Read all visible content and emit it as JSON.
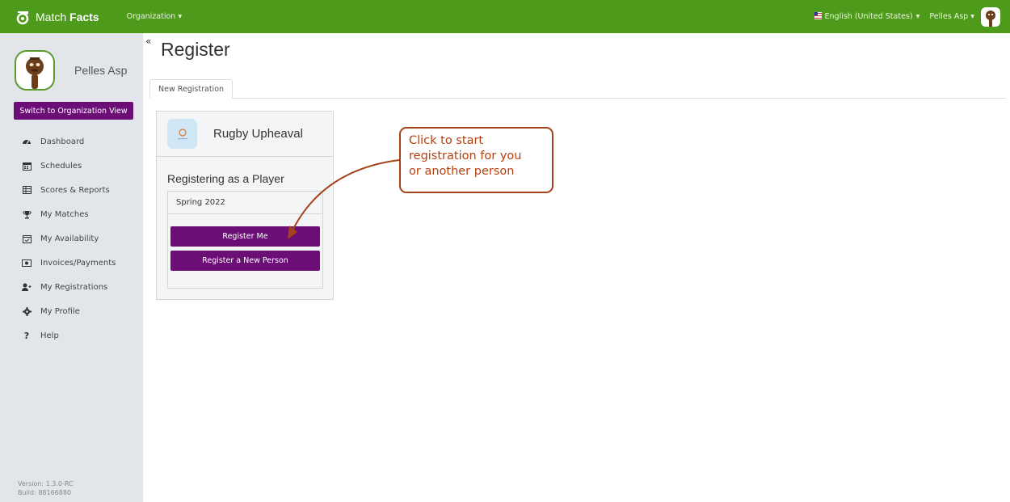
{
  "header": {
    "logo_light": "Match ",
    "logo_bold": "Facts",
    "org_menu": "Organization ▾",
    "language": "English (United States)",
    "user": "Pelles Asp"
  },
  "sidebar": {
    "profile_name": "Pelles Asp",
    "switch_button": "Switch to Organization View",
    "items": [
      {
        "label": "Dashboard",
        "icon": "dashboard-icon"
      },
      {
        "label": "Schedules",
        "icon": "calendar-icon"
      },
      {
        "label": "Scores & Reports",
        "icon": "table-icon"
      },
      {
        "label": "My Matches",
        "icon": "trophy-icon"
      },
      {
        "label": "My Availability",
        "icon": "calendar-check-icon"
      },
      {
        "label": "Invoices/Payments",
        "icon": "money-icon"
      },
      {
        "label": "My Registrations",
        "icon": "user-plus-icon"
      },
      {
        "label": "My Profile",
        "icon": "gear-icon"
      },
      {
        "label": "Help",
        "icon": "question-icon"
      }
    ],
    "version": "Version: 1.3.0-RC",
    "build": "Build: 88166880"
  },
  "main": {
    "collapse": "«",
    "title": "Register",
    "tab": "New Registration",
    "card": {
      "org_name": "Rugby Upheaval",
      "registering_as": "Registering as a Player",
      "season": "Spring 2022",
      "register_me": "Register Me",
      "register_new": "Register a New Person"
    },
    "callout": {
      "line1": "Click to start",
      "line2": "registration for you",
      "line3": "or another person"
    }
  },
  "colors": {
    "topbar": "#4e9a1a",
    "primary_button": "#6b0f77",
    "sidebar_bg": "#e2e5ea",
    "callout": "#a5421a"
  }
}
